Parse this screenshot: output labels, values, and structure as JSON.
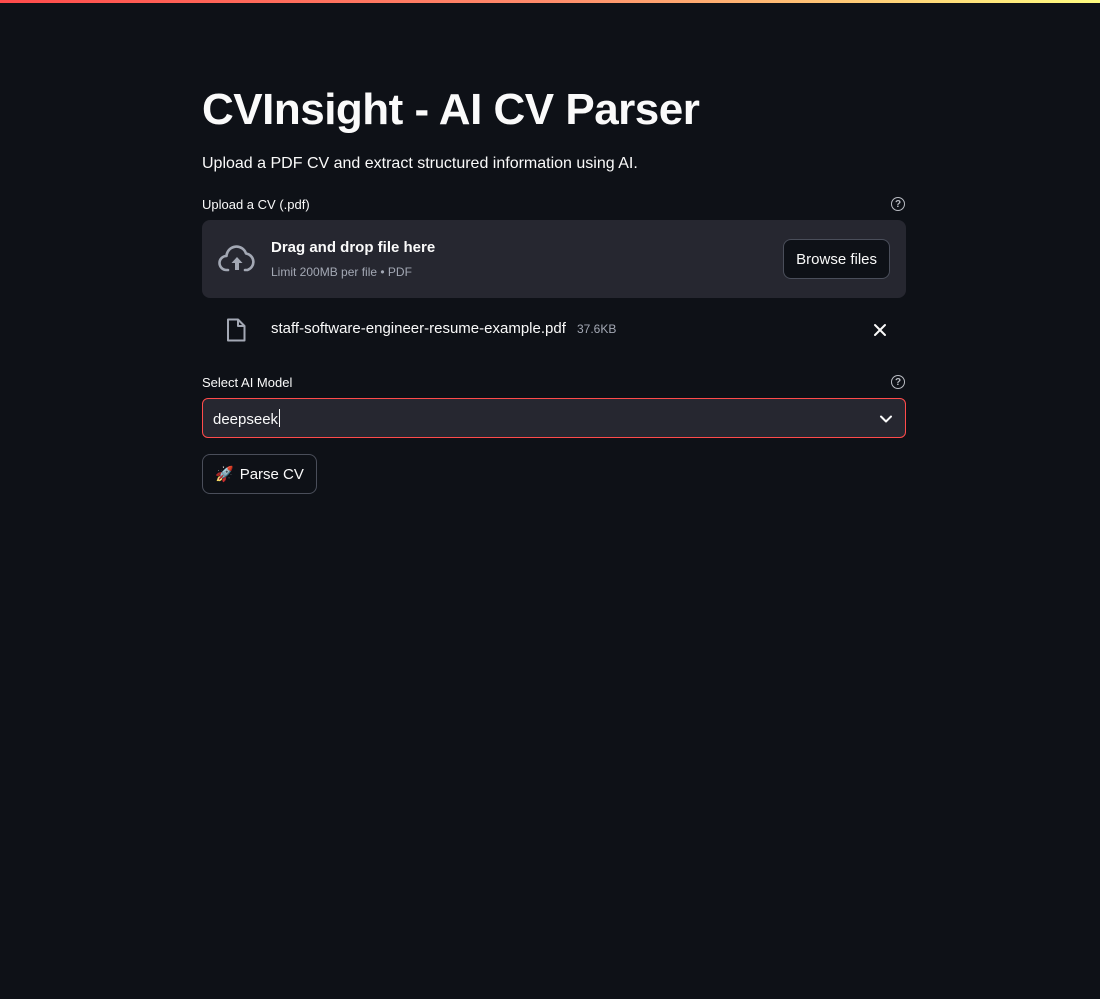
{
  "page": {
    "title": "CVInsight - AI CV Parser",
    "subtitle": "Upload a PDF CV and extract structured information using AI."
  },
  "uploader": {
    "label": "Upload a CV (.pdf)",
    "help_icon": "question-circle-icon",
    "dropzone_title": "Drag and drop file here",
    "dropzone_limit": "Limit 200MB per file • PDF",
    "browse_label": "Browse files",
    "cloud_icon": "cloud-upload-icon"
  },
  "uploaded_file": {
    "icon": "file-icon",
    "name": "staff-software-engineer-resume-example.pdf",
    "size": "37.6KB",
    "remove_icon": "close-icon"
  },
  "model_select": {
    "label": "Select AI Model",
    "help_icon": "question-circle-icon",
    "value": "deepseek",
    "chevron_icon": "chevron-down-icon"
  },
  "parse_button": {
    "emoji": "🚀",
    "label": "Parse CV"
  },
  "colors": {
    "background": "#0e1117",
    "panel": "#262730",
    "accent": "#ff4b4b",
    "text": "#fafafa",
    "muted": "#a3a8b4"
  }
}
